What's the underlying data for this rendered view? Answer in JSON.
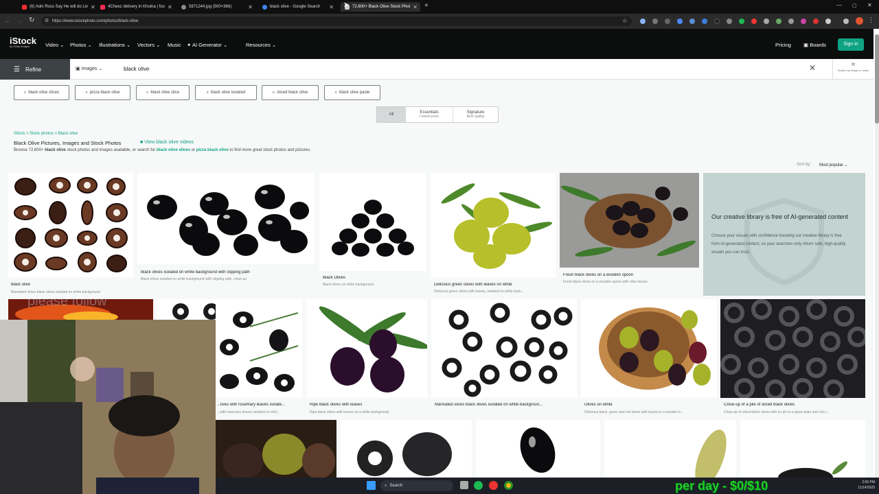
{
  "browser": {
    "tabs": [
      {
        "label": "(6) Adin Ross Say He will do Liv",
        "color": "#ff2d2d"
      },
      {
        "label": "4Cheez delivery in Khulna | foo",
        "color": "#ff2d55"
      },
      {
        "label": "5871244.jpg (500×366)",
        "color": "#8a8a8a"
      },
      {
        "label": "black olive - Google Search",
        "color": "#4285f4"
      },
      {
        "label": "72,600+ Black Olive Stock Phot",
        "color": "#cccccc"
      }
    ],
    "url": "https://www.istockphoto.com/photos/black-olive"
  },
  "nav": {
    "logo": "iStock",
    "logo_sub": "by Getty Images",
    "items": [
      "Video",
      "Photos",
      "Illustrations",
      "Vectors",
      "Music",
      "AI Generator",
      "Resources"
    ],
    "pricing": "Pricing",
    "boards": "Boards",
    "signin": "Sign in"
  },
  "search": {
    "refine": "Refine",
    "type": "Images",
    "query": "black olive",
    "by_image": "Search by image or video"
  },
  "chips": [
    "black olive slices",
    "pizza black olive",
    "black olive slice",
    "black olive isolated",
    "sliced black olive",
    "black olive paste"
  ],
  "filters": [
    {
      "label": "All",
      "sub": ""
    },
    {
      "label": "Essentials",
      "sub": "Lowest price"
    },
    {
      "label": "Signature",
      "sub": "Best quality"
    }
  ],
  "breadcrumb": "iStock > Stock photos > Black olive",
  "heading": "Black Olive Pictures, Images and Stock Photos",
  "video_link": "View black olive videos",
  "browse": {
    "pre": "Browse 72,600+",
    "bold": "black olive",
    "mid": "stock photos and images available, or search for",
    "link1": "black olive slices",
    "or": "or",
    "link2": "pizza black olive",
    "post": "to find more great stock photos and pictures."
  },
  "sort": {
    "label": "Sort by:",
    "value": "Most popular"
  },
  "row1": [
    {
      "title": "black olive",
      "sub": "Marinated olives black olives isolated on white background"
    },
    {
      "title": "Black olives isolated on white background with clipping path",
      "sub": "Black olives isolated on white background with clipping path, close-up"
    },
    {
      "title": "Black Olives",
      "sub": "Black olives on white background."
    },
    {
      "title": "Delicious green olives with leaves on white",
      "sub": "Delicious green olives with leaves, isolated on white back..."
    },
    {
      "title": "Fresh black olives on a wooden spoon",
      "sub": "Fresh black olives on a wooden spoon with olive leaves"
    }
  ],
  "promo": {
    "title": "Our creative library is free of AI-generated content",
    "body": "Choose your visuals with confidence knowing our creative library is free from AI-generated content, so your searches only return safe, high-quality visuals you can trust."
  },
  "row2": [
    {
      "title": "...lives with rosemary leaves isolate...",
      "sub": "...with rosemary leaves isolated on whit..."
    },
    {
      "title": "Ripe black olives with leaves",
      "sub": "Ripe black olives with leaves on a white background"
    },
    {
      "title": "Marinated slices black olives isolated on white backgroun...",
      "sub": ""
    },
    {
      "title": "Olives on white",
      "sub": "Delicious black, green and red olives with leaves in a wooden b..."
    },
    {
      "title": "Close-up of a pile of sliced black olives",
      "sub": "Close-up of sliced black olives with no pit on a glass plate and red c..."
    }
  ],
  "stream_watermark": "please follow",
  "taskbar": {
    "search": "Search",
    "time": "2:06 PM",
    "date": "11/14/2025"
  },
  "overlay": "per day - $0/$10"
}
